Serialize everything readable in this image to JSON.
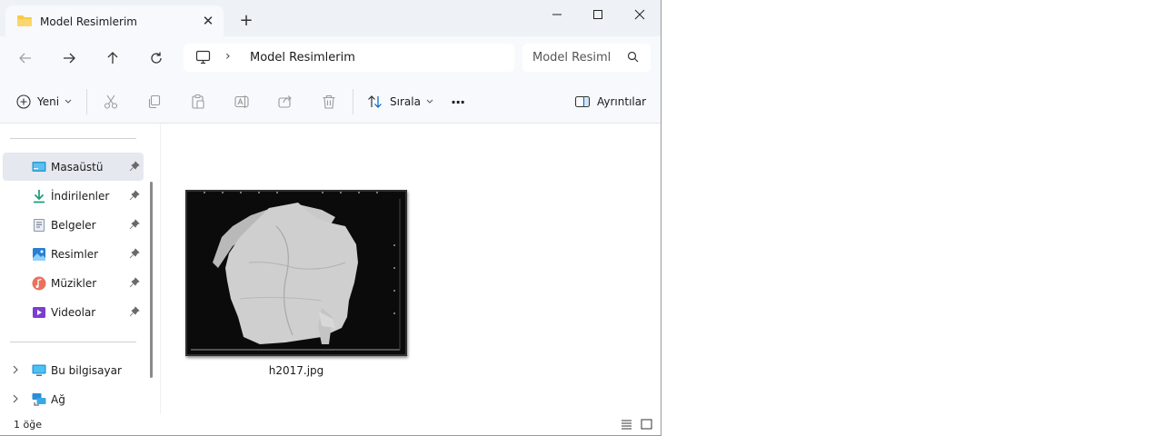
{
  "window": {
    "tab_title": "Model Resimlerim",
    "tab_close": "✕",
    "new_tab": "+"
  },
  "address": {
    "separator": "›",
    "crumb": "Model Resimlerim",
    "search_placeholder": "Model Resiml"
  },
  "commands": {
    "new_label": "Yeni",
    "sort_label": "Sırala",
    "more_label": "···",
    "details_label": "Ayrıntılar"
  },
  "sidebar": {
    "quick_access": [
      {
        "label": "Masaüstü",
        "icon": "desktop-icon"
      },
      {
        "label": "İndirilenler",
        "icon": "download-icon"
      },
      {
        "label": "Belgeler",
        "icon": "documents-icon"
      },
      {
        "label": "Resimler",
        "icon": "pictures-icon"
      },
      {
        "label": "Müzikler",
        "icon": "music-icon"
      },
      {
        "label": "Videolar",
        "icon": "videos-icon"
      }
    ],
    "locations": [
      {
        "label": "Bu bilgisayar",
        "icon": "this-pc-icon"
      },
      {
        "label": "Ağ",
        "icon": "network-icon"
      }
    ]
  },
  "content": {
    "files": [
      {
        "name": "h2017.jpg"
      }
    ]
  },
  "status": {
    "item_count": "1 öğe"
  },
  "colors": {
    "accent": "#0067c0",
    "folder": "#f8c94a",
    "selection": "#e5e8ee"
  }
}
